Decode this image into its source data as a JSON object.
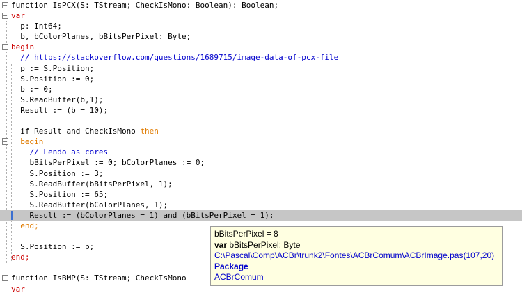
{
  "code": {
    "lines": [
      {
        "fold": "minus",
        "tokens": [
          {
            "t": "function IsPCX(S: TStream; CheckIsMono: Boolean): Boolean;",
            "c": ""
          }
        ]
      },
      {
        "fold": "minus",
        "tokens": [
          {
            "t": "var",
            "c": "kw"
          }
        ]
      },
      {
        "fold": "",
        "tokens": [
          {
            "t": "  p: Int64;",
            "c": ""
          }
        ]
      },
      {
        "fold": "",
        "tokens": [
          {
            "t": "  b, bColorPlanes, bBitsPerPixel: Byte;",
            "c": ""
          }
        ]
      },
      {
        "fold": "minus",
        "tokens": [
          {
            "t": "begin",
            "c": "kw"
          }
        ]
      },
      {
        "fold": "",
        "tokens": [
          {
            "t": "  // https://stackoverflow.com/questions/1689715/image-data-of-pcx-file",
            "c": "cm"
          }
        ]
      },
      {
        "fold": "",
        "tokens": [
          {
            "t": "  p := S.Position;",
            "c": ""
          }
        ]
      },
      {
        "fold": "",
        "tokens": [
          {
            "t": "  S.Position := 0;",
            "c": ""
          }
        ]
      },
      {
        "fold": "",
        "tokens": [
          {
            "t": "  b := 0;",
            "c": ""
          }
        ]
      },
      {
        "fold": "",
        "tokens": [
          {
            "t": "  S.ReadBuffer(b,1);",
            "c": ""
          }
        ]
      },
      {
        "fold": "",
        "tokens": [
          {
            "t": "  Result := (b = 10);",
            "c": ""
          }
        ]
      },
      {
        "fold": "",
        "tokens": [
          {
            "t": "",
            "c": ""
          }
        ]
      },
      {
        "fold": "",
        "tokens": [
          {
            "t": "  if Result and CheckIsMono ",
            "c": ""
          },
          {
            "t": "then",
            "c": "kw2"
          }
        ]
      },
      {
        "fold": "minus",
        "tokens": [
          {
            "t": "  begin",
            "c": "kw2"
          }
        ]
      },
      {
        "fold": "",
        "tokens": [
          {
            "t": "    // Lendo as cores",
            "c": "cm"
          }
        ]
      },
      {
        "fold": "",
        "tokens": [
          {
            "t": "    bBitsPerPixel := 0; bColorPlanes := 0;",
            "c": ""
          }
        ]
      },
      {
        "fold": "",
        "tokens": [
          {
            "t": "    S.Position := 3;",
            "c": ""
          }
        ]
      },
      {
        "fold": "",
        "tokens": [
          {
            "t": "    S.ReadBuffer(bBitsPerPixel, 1);",
            "c": ""
          }
        ]
      },
      {
        "fold": "",
        "tokens": [
          {
            "t": "    S.Position := 65;",
            "c": ""
          }
        ]
      },
      {
        "fold": "",
        "tokens": [
          {
            "t": "    S.ReadBuffer(bColorPlanes, 1);",
            "c": ""
          }
        ]
      },
      {
        "fold": "",
        "highlight": true,
        "tokens": [
          {
            "t": "    Result := (bColorPlanes = 1) and (bBitsPerPixel = 1);",
            "c": ""
          }
        ]
      },
      {
        "fold": "",
        "tokens": [
          {
            "t": "  end;",
            "c": "kw2"
          }
        ]
      },
      {
        "fold": "",
        "tokens": [
          {
            "t": "",
            "c": ""
          }
        ]
      },
      {
        "fold": "",
        "tokens": [
          {
            "t": "  S.Position := p;",
            "c": ""
          }
        ]
      },
      {
        "fold": "",
        "tokens": [
          {
            "t": "end;",
            "c": "kw"
          }
        ]
      },
      {
        "fold": "",
        "tokens": [
          {
            "t": "",
            "c": ""
          }
        ]
      },
      {
        "fold": "minus",
        "tokens": [
          {
            "t": "function IsBMP(S: TStream; CheckIsMono",
            "c": ""
          }
        ]
      },
      {
        "fold": "",
        "tokens": [
          {
            "t": "var",
            "c": "kw"
          }
        ]
      }
    ]
  },
  "tooltip": {
    "value_line": "bBitsPerPixel = 8",
    "decl_keyword": "var",
    "decl_rest": " bBitsPerPixel: Byte",
    "path": "C:\\Pascal\\Comp\\ACBr\\trunk2\\Fontes\\ACBrComum\\ACBrImage.pas(107,20)",
    "package_heading": "Package",
    "package_name": "ACBrComum"
  },
  "colors": {
    "keyword": "#cc0000",
    "block_keyword": "#e07b00",
    "comment": "#0000cc",
    "highlight": "#c6c6c6",
    "tooltip_bg": "#ffffe1"
  }
}
